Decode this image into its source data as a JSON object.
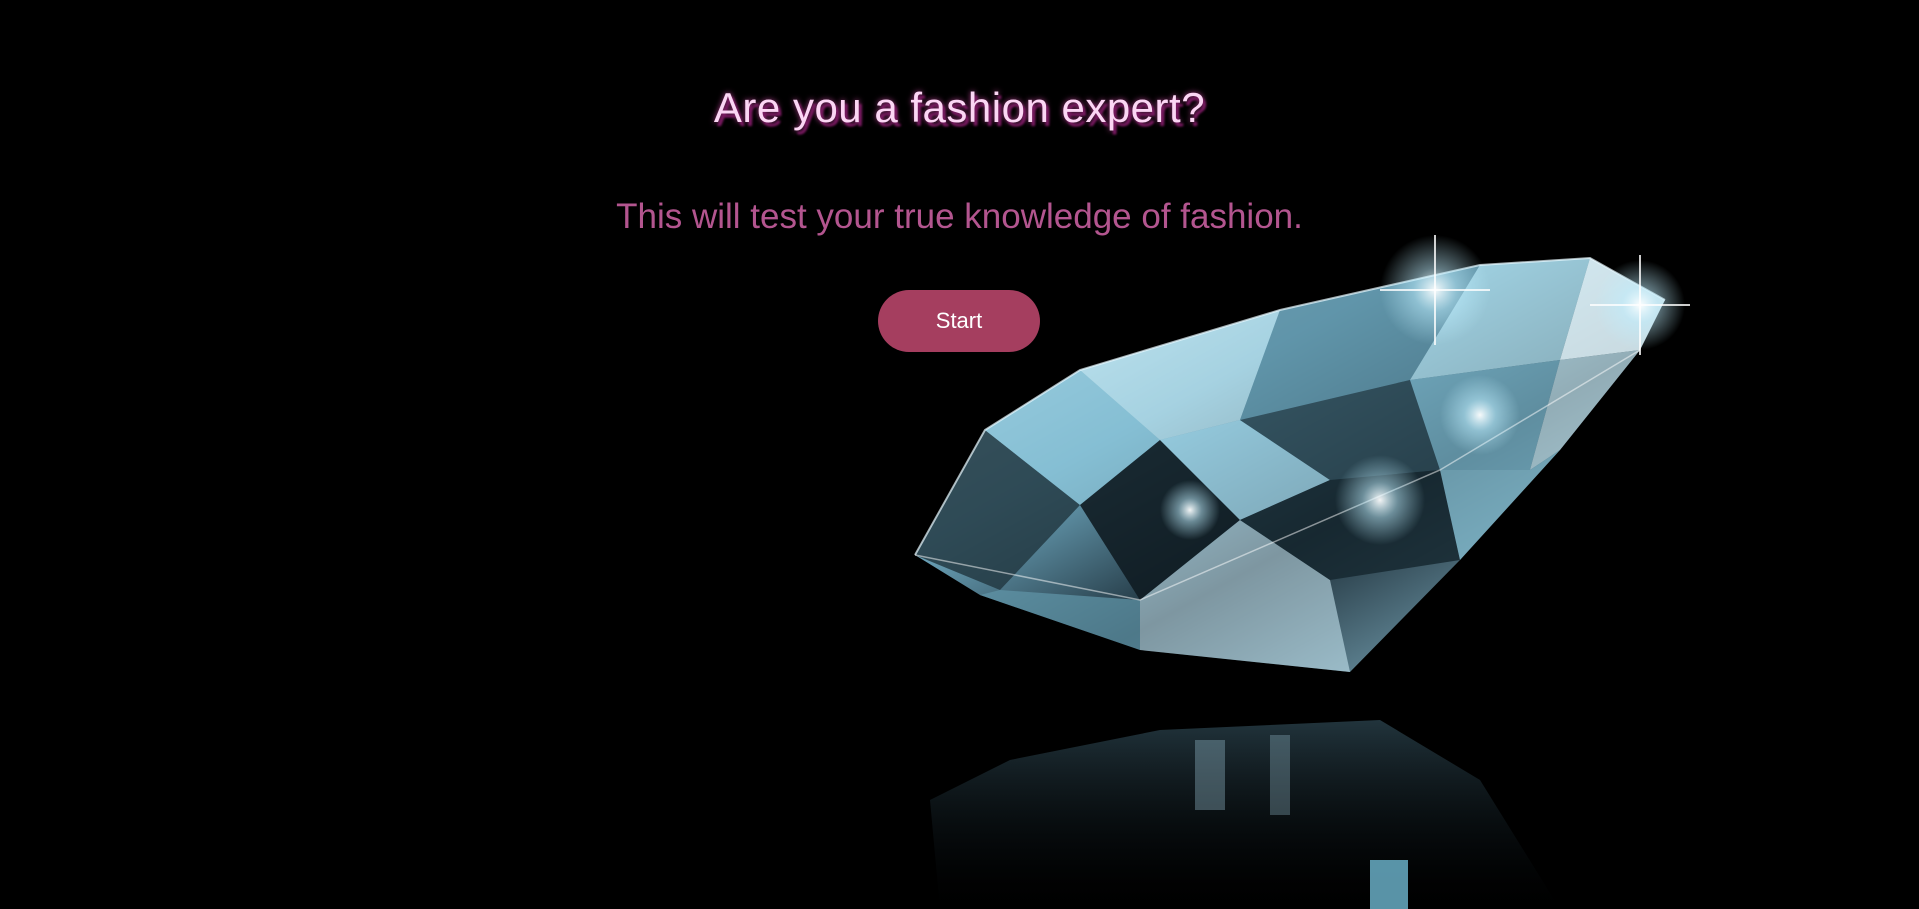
{
  "hero": {
    "title": "Are you a fashion expert?",
    "subtitle": "This will test your true knowledge of fashion.",
    "start_label": "Start",
    "background_image": "diamond-illustration"
  },
  "colors": {
    "background": "#000000",
    "title": "#fbd6f4",
    "title_shadow": "#7a1a62",
    "subtitle": "#b3558f",
    "button": "#a53e5f",
    "button_text": "#ffffff"
  }
}
